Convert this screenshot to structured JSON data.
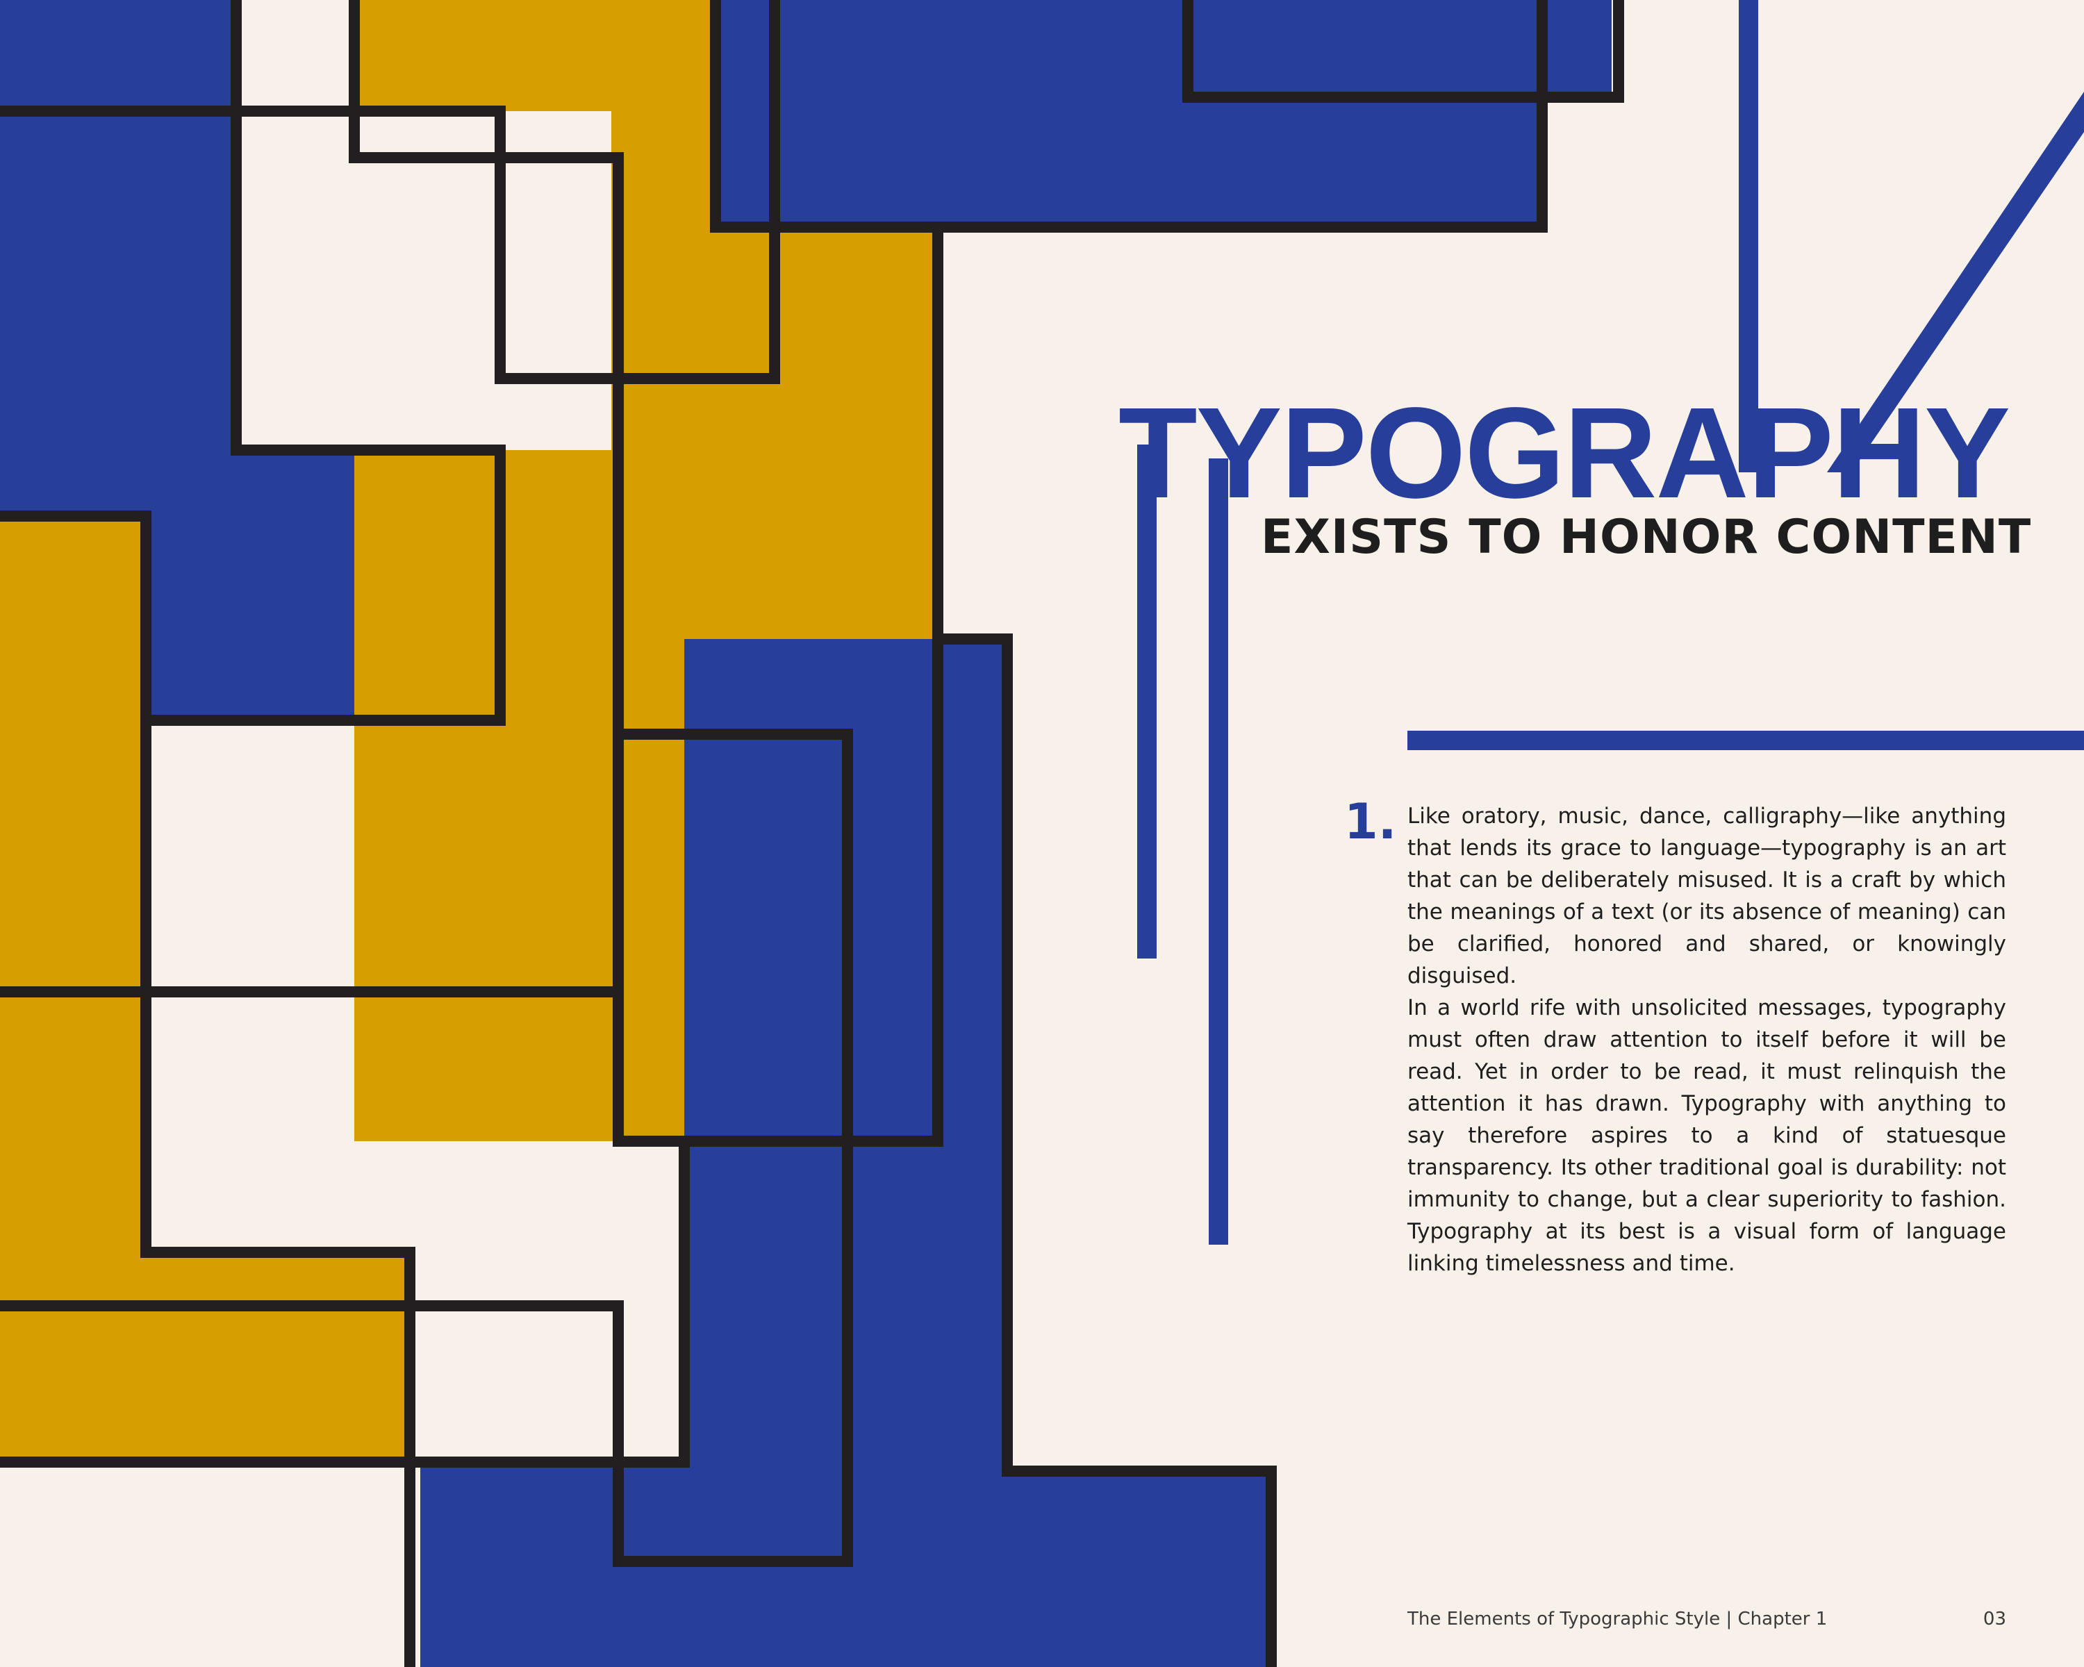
{
  "colors": {
    "background": "#F8F1E9",
    "blue": "#283E9B",
    "gold": "#D69E00",
    "line": "#231F20",
    "text": "#1F1E1F"
  },
  "heading": {
    "title": "TYPOGRAPHY",
    "subtitle": "EXISTS TO HONOR CONTENT"
  },
  "section": {
    "number": "1.",
    "paragraphs": [
      "Like oratory, music, dance, calligraphy—like anything that lends its grace to language—typography is an art that can be deliberately misused. It is a craft by which the meanings of a text (or its absence of meaning) can be clarified, honored and shared, or knowingly disguised.",
      "In a world rife with unsolicited messages, typography must often draw attention to itself before it will be read. Yet in order to be read, it must relinquish the attention it has drawn. Typography with anything to say therefore aspires to a kind of statuesque transparency. Its other traditional goal is durability: not immunity to change, but a clear superiority to fashion. Typography at its best is a visual form of language linking timelessness and time."
    ]
  },
  "footer": {
    "book": "The Elements of Typographic Style | Chapter 1",
    "page": "03"
  }
}
